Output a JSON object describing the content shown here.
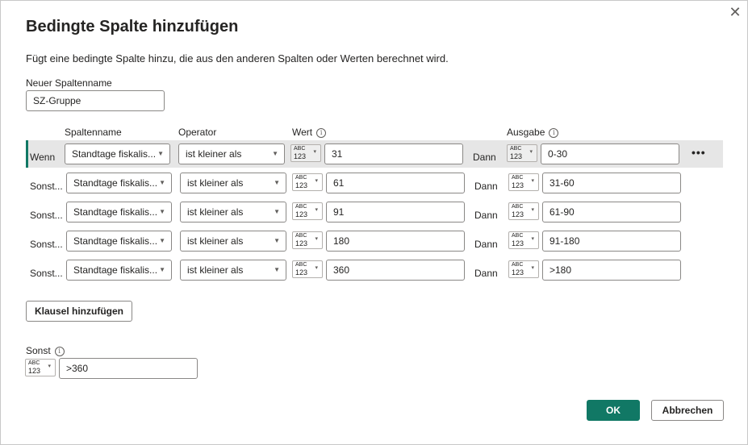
{
  "dialog": {
    "title": "Bedingte Spalte hinzufügen",
    "subtitle": "Fügt eine bedingte Spalte hinzu, die aus den anderen Spalten oder Werten berechnet wird.",
    "close_glyph": "✕"
  },
  "column_name": {
    "label": "Neuer Spaltenname",
    "value": "SZ-Gruppe"
  },
  "headers": {
    "column": "Spaltenname",
    "operator": "Operator",
    "value": "Wert",
    "output": "Ausgabe",
    "info_glyph": "i"
  },
  "type_button": {
    "line1": "ABC",
    "line2": "123",
    "caret": "▾"
  },
  "dann_label": "Dann",
  "more_glyph": "•••",
  "rules": [
    {
      "prefix": "Wenn",
      "column": "Standtage fiskalis...",
      "operator": "ist kleiner als",
      "value": "31",
      "output": "0-30"
    },
    {
      "prefix": "Sonst...",
      "column": "Standtage fiskalis...",
      "operator": "ist kleiner als",
      "value": "61",
      "output": "31-60"
    },
    {
      "prefix": "Sonst...",
      "column": "Standtage fiskalis...",
      "operator": "ist kleiner als",
      "value": "91",
      "output": "61-90"
    },
    {
      "prefix": "Sonst...",
      "column": "Standtage fiskalis...",
      "operator": "ist kleiner als",
      "value": "180",
      "output": "91-180"
    },
    {
      "prefix": "Sonst...",
      "column": "Standtage fiskalis...",
      "operator": "ist kleiner als",
      "value": "360",
      "output": ">180"
    }
  ],
  "add_clause_label": "Klausel hinzufügen",
  "else": {
    "label": "Sonst",
    "value": ">360"
  },
  "buttons": {
    "ok": "OK",
    "cancel": "Abbrechen"
  },
  "colors": {
    "accent": "#117865",
    "highlight_row": "#e6e6e6"
  }
}
